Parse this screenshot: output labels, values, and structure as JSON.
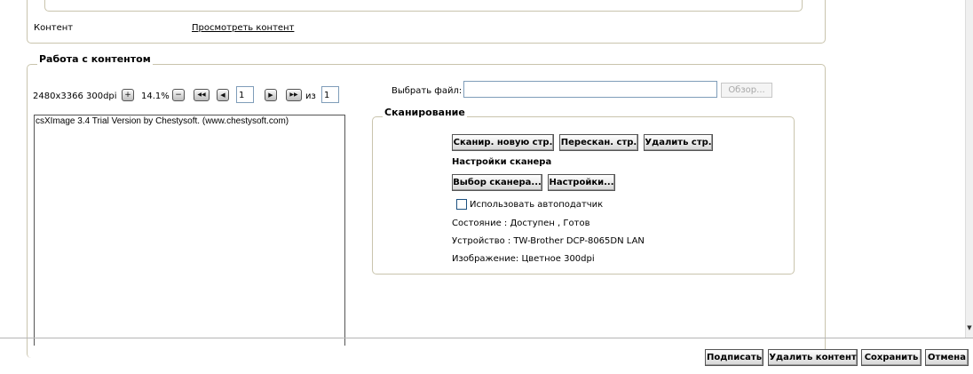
{
  "content_row": {
    "label": "Контент",
    "link": "Просмотреть контент"
  },
  "work": {
    "legend": "Работа с контентом",
    "image_info": "2480x3366 300dpi",
    "zoom": "14.1%",
    "zoom_in_symbol": "+",
    "zoom_out_symbol": "−",
    "first_symbol": "◀◀",
    "prev_symbol": "◀",
    "next_symbol": "▶",
    "last_symbol": "▶▶",
    "page_current": "1",
    "page_of_label": "из",
    "page_total": "1",
    "preview_text": "csXImage 3.4 Trial Version by Chestysoft. (www.chestysoft.com)"
  },
  "file": {
    "label": "Выбрать файл:",
    "value": "",
    "browse": "Обзор..."
  },
  "scan": {
    "legend": "Сканирование",
    "new_page": "Сканир. новую стр.",
    "rescan": "Перескан. стр.",
    "delete_page": "Удалить стр.",
    "settings_heading": "Настройки сканера",
    "select_scanner": "Выбор сканера...",
    "settings": "Настройки...",
    "use_feeder": "Использовать автоподатчик",
    "status": "Состояние : Доступен , Готов",
    "device": "Устройство : TW-Brother DCP-8065DN LAN",
    "image": "Изображение: Цветное  300dpi"
  },
  "footer": {
    "sign": "Подписать",
    "delete_content": "Удалить контент",
    "save": "Сохранить",
    "cancel": "Отмена"
  },
  "scrollbar": {
    "down_arrow": "▼"
  }
}
